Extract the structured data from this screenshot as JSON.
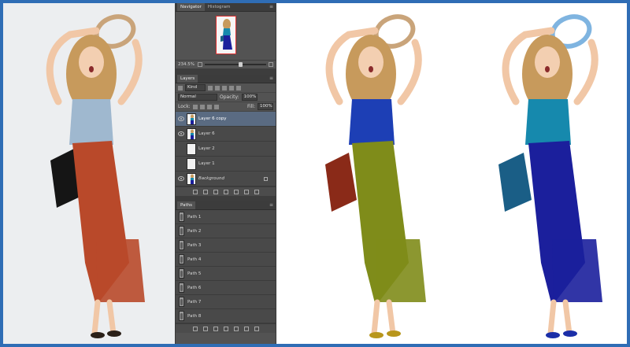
{
  "colors": {
    "border": "#2f6db5",
    "original": {
      "top": "#9fb8cf",
      "skirt": "#b9492a",
      "bag": "#151515",
      "hair": "#c79a5c"
    },
    "green_variant": {
      "top": "#1d3fb5",
      "skirt": "#7f8c1a",
      "bag": "#8a2a18",
      "hair": "#c79a5c"
    },
    "blue_variant": {
      "top": "#1689ad",
      "skirt": "#1b1f9c",
      "bag": "#1a5e86",
      "hair": "#c79a5c"
    }
  },
  "navigator": {
    "tabs": [
      "Navigator",
      "Histogram"
    ],
    "zoom_value": "234.5%"
  },
  "layers_panel": {
    "tab": "Layers",
    "filter_kind": "Kind",
    "blend_mode": "Normal",
    "opacity_label": "Opacity:",
    "opacity_value": "100%",
    "lock_label": "Lock:",
    "fill_label": "Fill:",
    "fill_value": "100%",
    "layers": [
      {
        "name": "Layer 6 copy",
        "selected": true,
        "visible": true
      },
      {
        "name": "Layer 6",
        "selected": false,
        "visible": true
      },
      {
        "name": "Layer 2",
        "selected": false,
        "visible": false
      },
      {
        "name": "Layer 1",
        "selected": false,
        "visible": false
      },
      {
        "name": "Background",
        "selected": false,
        "visible": true
      }
    ]
  },
  "paths_panel": {
    "tab": "Paths",
    "paths": [
      "Path 1",
      "Path 2",
      "Path 3",
      "Path 4",
      "Path 5",
      "Path 6",
      "Path 7",
      "Path 8"
    ]
  }
}
